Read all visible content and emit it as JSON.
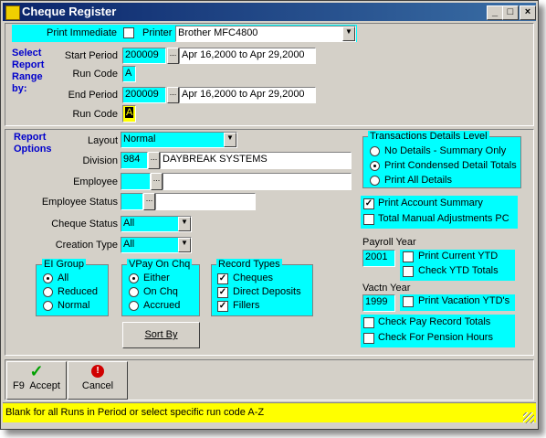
{
  "window": {
    "title": "Cheque Register"
  },
  "titlebar_buttons": {
    "minimize": "_",
    "maximize": "□",
    "close": "×"
  },
  "header": {
    "print_immediate_label": "Print Immediate",
    "printer_label": "Printer",
    "printer_value": "Brother MFC4800",
    "select_label": "Select Report Range by:",
    "start_period_label": "Start Period",
    "start_period_value": "200009",
    "start_period_range": "Apr 16,2000 to Apr 29,2000",
    "run_code_label": "Run Code",
    "run_code_value": "A",
    "end_period_label": "End Period",
    "end_period_value": "200009",
    "end_period_range": "Apr 16,2000 to Apr 29,2000",
    "run_code2_label": "Run Code",
    "run_code2_value": "A",
    "ellipsis": "..."
  },
  "options": {
    "title": "Report Options",
    "layout_label": "Layout",
    "layout_value": "Normal",
    "division_label": "Division",
    "division_code": "984",
    "division_name": "DAYBREAK SYSTEMS",
    "employee_label": "Employee",
    "employee_status_label": "Employee Status",
    "cheque_status_label": "Cheque Status",
    "cheque_status_value": "All",
    "creation_type_label": "Creation Type",
    "creation_type_value": "All"
  },
  "ei_group": {
    "title": "EI Group",
    "options": [
      "All",
      "Reduced",
      "Normal"
    ],
    "selected": 0
  },
  "vpay": {
    "title": "VPay On Chq",
    "options": [
      "Either",
      "On Chq",
      "Accrued"
    ],
    "selected": 0
  },
  "record_types": {
    "title": "Record Types",
    "options": [
      "Cheques",
      "Direct Deposits",
      "Fillers"
    ]
  },
  "sort_by_label": "Sort By",
  "details_level": {
    "title": "Transactions Details Level",
    "options": [
      "No Details - Summary Only",
      "Print Condensed Detail Totals",
      "Print All Details"
    ],
    "selected": 1
  },
  "account": {
    "print_account_summary": "Print Account Summary",
    "total_manual": "Total Manual Adjustments PC"
  },
  "payroll_year": {
    "label": "Payroll Year",
    "value": "2001",
    "print_current": "Print Current YTD",
    "check_ytd": "Check YTD Totals"
  },
  "vactn_year": {
    "label": "Vactn Year",
    "value": "1999",
    "print_vacation": "Print Vacation YTD's"
  },
  "checks": {
    "pay_record": "Check Pay Record Totals",
    "pension": "Check For Pension Hours"
  },
  "toolbar": {
    "accept_label": "F9  Accept",
    "cancel_label": "Cancel"
  },
  "status_text": "Blank for all Runs in Period or select specific run code A-Z"
}
